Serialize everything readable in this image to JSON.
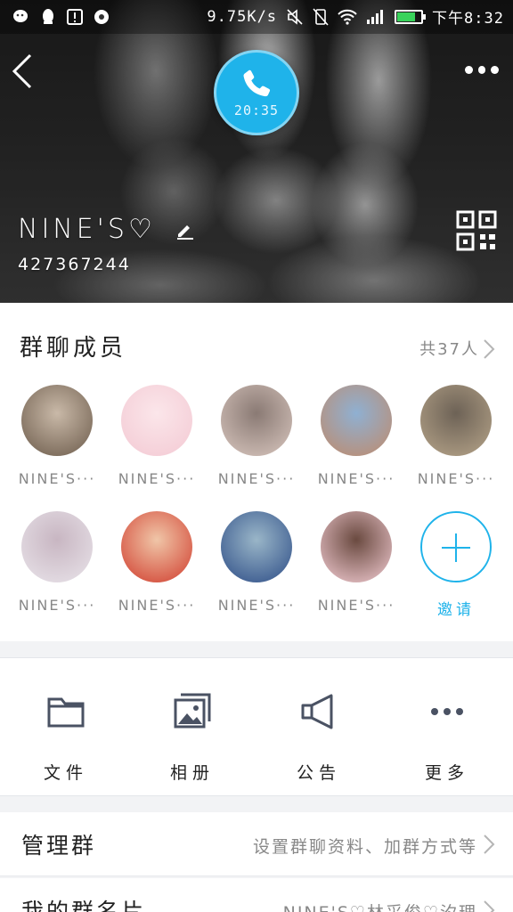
{
  "status_bar": {
    "network_speed": "9.75K/s",
    "time": "下午8:32",
    "battery_level": 0.75
  },
  "header": {
    "call_time": "20:35",
    "group_name": "NINE'S♡",
    "group_id": "427367244"
  },
  "members": {
    "title": "群聊成员",
    "count": "共37人",
    "list": [
      {
        "name": "NINE'S···",
        "avatar_colors": [
          "#6b5a4a",
          "#c9b9a8"
        ]
      },
      {
        "name": "NINE'S···",
        "avatar_colors": [
          "#f3c9d3",
          "#fbe6ea"
        ]
      },
      {
        "name": "NINE'S···",
        "avatar_colors": [
          "#d9c7bf",
          "#8a7a74"
        ]
      },
      {
        "name": "NINE'S···",
        "avatar_colors": [
          "#c08a6a",
          "#8fb0d2"
        ]
      },
      {
        "name": "NINE'S···",
        "avatar_colors": [
          "#b7a58a",
          "#6d6256"
        ]
      },
      {
        "name": "NINE'S···",
        "avatar_colors": [
          "#e9e4ea",
          "#c8b6c2"
        ]
      },
      {
        "name": "NINE'S···",
        "avatar_colors": [
          "#d03b2c",
          "#f0c6a8"
        ]
      },
      {
        "name": "NINE'S···",
        "avatar_colors": [
          "#2c4c86",
          "#9ab6c8"
        ]
      },
      {
        "name": "NINE'S···",
        "avatar_colors": [
          "#f4cdd4",
          "#6a4a40"
        ]
      }
    ],
    "invite_label": "邀请"
  },
  "shortcuts": [
    {
      "label": "文件",
      "icon": "folder-icon"
    },
    {
      "label": "相册",
      "icon": "album-icon"
    },
    {
      "label": "公告",
      "icon": "megaphone-icon"
    },
    {
      "label": "更多",
      "icon": "more-dots-icon"
    }
  ],
  "rows": {
    "manage_label": "管理群",
    "manage_value": "设置群聊资料、加群方式等",
    "card_label": "我的群名片",
    "card_value": "NINE'S♡林采俊♡汐理"
  },
  "colors": {
    "accent": "#1fb3ea",
    "icon_gray": "#4a5263"
  }
}
